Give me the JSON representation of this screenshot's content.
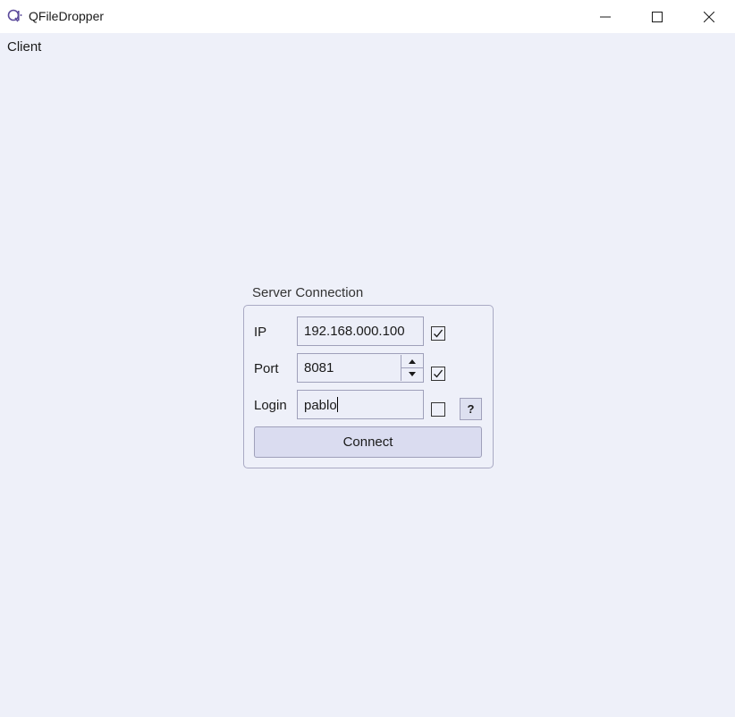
{
  "window": {
    "title": "QFileDropper",
    "icon": "qt-app-icon",
    "controls": [
      "minimize-icon",
      "maximize-icon",
      "close-icon"
    ]
  },
  "menu": {
    "items": [
      {
        "label": "Client"
      }
    ]
  },
  "server_connection": {
    "title": "Server Connection",
    "ip": {
      "label": "IP",
      "value": "192.168.000.100",
      "checked": true
    },
    "port": {
      "label": "Port",
      "value": "8081",
      "checked": true
    },
    "login": {
      "label": "Login",
      "value": "pablo",
      "checked": false
    },
    "help_label": "?",
    "connect_label": "Connect"
  },
  "colors": {
    "background": "#eef0f9",
    "titlebar": "#ffffff",
    "field_border": "#9fa0ba",
    "button_bg": "#dadcf0"
  }
}
